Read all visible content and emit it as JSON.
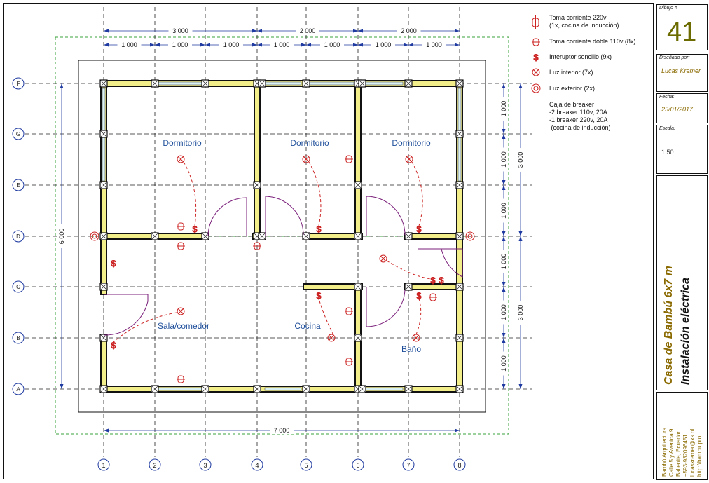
{
  "grid": {
    "columns": [
      "1",
      "2",
      "3",
      "4",
      "5",
      "6",
      "7",
      "8"
    ],
    "rows": [
      "F",
      "G",
      "E",
      "D",
      "C",
      "B",
      "A"
    ]
  },
  "dimensions": {
    "top_major": [
      "3 000",
      "2 000",
      "2 000"
    ],
    "top_minor": [
      "1 000",
      "1 000",
      "1 000",
      "1 000",
      "1 000",
      "1 000",
      "1 000"
    ],
    "left_overall": "6 000",
    "right_minor": [
      "1 000",
      "1 000",
      "1 000",
      "1 000",
      "1 000",
      "1 000"
    ],
    "right_major": [
      "3 000",
      "3 000"
    ],
    "bottom_overall": "7 000"
  },
  "rooms": [
    "Dormitorio",
    "Dormitorio",
    "Dormitorio",
    "Sala/comedor",
    "Cocina",
    "Baño"
  ],
  "legend": [
    {
      "icon": "outlet-220v-icon",
      "text": "Toma corriente 220v\n(1x, cocina de inducción)"
    },
    {
      "icon": "double-outlet-110v-icon",
      "text": "Toma corriente doble 110v (8x)"
    },
    {
      "icon": "switch-icon",
      "text": "Interuptor sencillo (9x)"
    },
    {
      "icon": "interior-light-icon",
      "text": "Luz interior (7x)"
    },
    {
      "icon": "exterior-light-icon",
      "text": "Luz exterior (2x)"
    },
    {
      "icon": "",
      "text": "Caja de breaker\n-2 breaker 110v, 20A\n-1 breaker 220v, 20A\n (cocina de inducción)"
    }
  ],
  "title_block": {
    "sheet_label": "Dibujo #",
    "sheet_number": "41",
    "drawn_label": "Diseñado por:",
    "drawn_by": "Lucas Kremer",
    "date_label": "Fecha:",
    "date": "25/01/2017",
    "scale_label": "Escala:",
    "scale": "1:50",
    "project": "Casa de Bambú 6x7 m",
    "drawing_title": "Instalación eléctrica",
    "company": [
      "Bambú Arquitectura",
      "Calle 5 y Avenida 9",
      "Ballenita, Ecuador",
      "+593-932096451",
      "lucaskremer@xs.nl",
      "http://bambu.pro"
    ]
  },
  "colors": {
    "wall_fill": "#f2ee8a",
    "wall_edge": "#111111",
    "wiring": "#cc2222",
    "door_swing": "#7a1f7a",
    "dimension": "#1f3aa0",
    "room_label": "#1f4f9a",
    "grid_line": "#222222",
    "boundary": "#3aa03a",
    "title_text": "#8a6a00"
  }
}
